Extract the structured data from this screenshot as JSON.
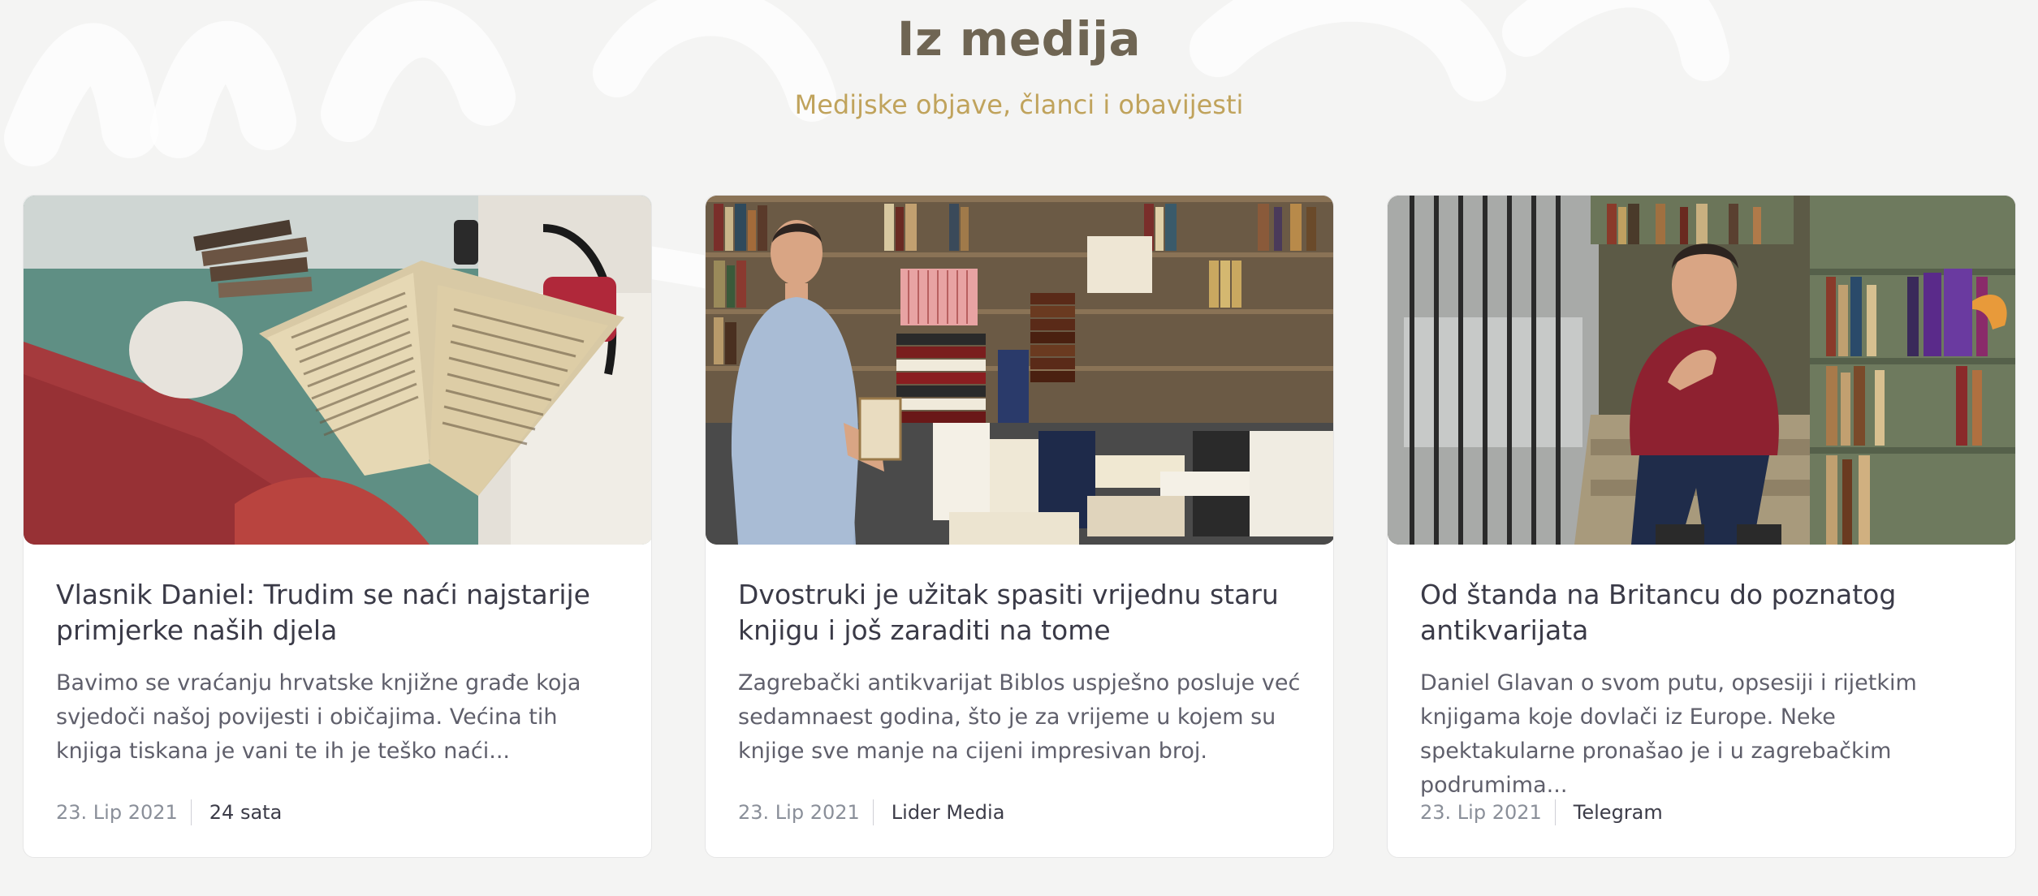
{
  "section": {
    "title": "Iz medija",
    "subtitle": "Medijske objave, članci i obavijesti"
  },
  "colors": {
    "background": "#f4f4f3",
    "title": "#6f6553",
    "subtitle": "#c0a35c",
    "card_title": "#3a3a47",
    "card_text": "#5f5f6b",
    "meta_date": "#8a8f99"
  },
  "cards": [
    {
      "image_alt": "photo-old-book-held-open",
      "title": "Vlasnik Daniel: Trudim se naći najstarije primjerke naših djela",
      "excerpt": "Bavimo se vraćanju hrvatske knjižne građe koja svjedoči našoj povijesti i običajima. Većina tih knjiga tiskana je vani te ih je teško naći...",
      "date": "23. Lip 2021",
      "source": "24 sata"
    },
    {
      "image_alt": "photo-man-in-bookshop",
      "title": "Dvostruki je užitak spasiti vrijednu staru knjigu i još zaraditi na tome",
      "excerpt": "Zagrebački antikvarijat Biblos uspješno posluje već sedamnaest godina, što je za vrijeme u kojem su knjige sve manje na cijeni impresivan broj.",
      "date": "23. Lip 2021",
      "source": "Lider Media"
    },
    {
      "image_alt": "photo-man-sitting-on-stairs-bookshelves",
      "title": "Od štanda na Britancu do poznatog antikvarijata",
      "excerpt": "Daniel Glavan o svom putu, opsesiji i rijetkim knjigama koje dovlači iz Europe. Neke spektakularne pronašao je i u zagrebačkim podrumima...",
      "date": "23. Lip 2021",
      "source": "Telegram"
    }
  ]
}
